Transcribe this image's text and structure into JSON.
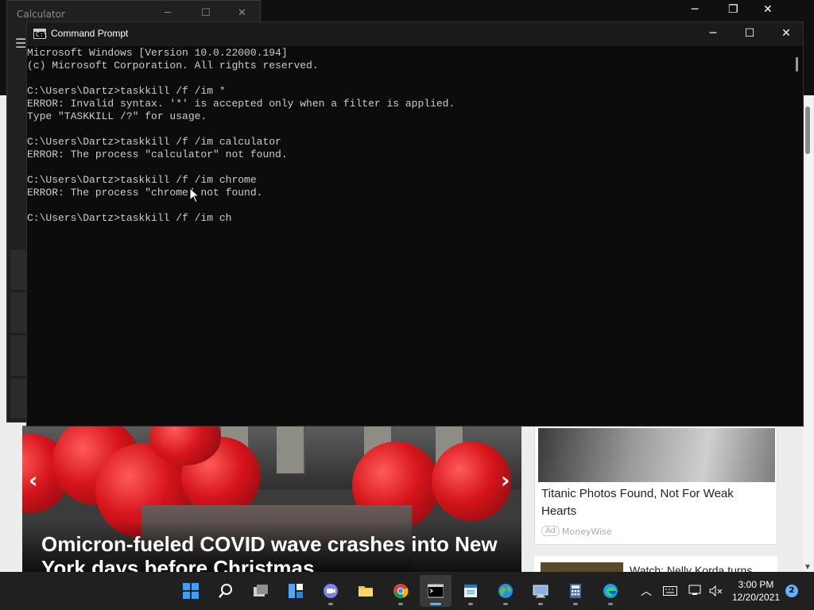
{
  "calculator": {
    "title": "Calculator",
    "minimize_icon": "minimize-icon",
    "maximize_icon": "maximize-icon",
    "close_icon": "close-icon",
    "menu_icon": "hamburger-icon"
  },
  "cmd": {
    "title": "Command Prompt",
    "app_icon": "cmd-icon",
    "lines": [
      "Microsoft Windows [Version 10.0.22000.194]",
      "(c) Microsoft Corporation. All rights reserved.",
      "",
      "C:\\Users\\Dartz>taskkill /f /im *",
      "ERROR: Invalid syntax. '*' is accepted only when a filter is applied.",
      "Type \"TASKKILL /?\" for usage.",
      "",
      "C:\\Users\\Dartz>taskkill /f /im calculator",
      "ERROR: The process \"calculator\" not found.",
      "",
      "C:\\Users\\Dartz>taskkill /f /im chrome",
      "ERROR: The process \"chrome\" not found.",
      "",
      "C:\\Users\\Dartz>taskkill /f /im ch"
    ]
  },
  "news": {
    "hero_headline": "Omicron-fueled COVID wave crashes into New York days before Christmas",
    "card1_title": "Titanic Photos Found, Not For Weak Hearts",
    "card1_ad": "Ad",
    "card1_source": "MoneyWise",
    "card2_title": "Watch: Nelly Korda turns"
  },
  "taskbar": {
    "time": "3:00 PM",
    "date": "12/20/2021",
    "notification_count": "2",
    "apps": [
      "start",
      "search",
      "task-view",
      "widgets",
      "teams-chat",
      "file-explorer",
      "chrome",
      "command-prompt",
      "notepad",
      "network-globe",
      "remote-desktop",
      "calculator",
      "edge"
    ]
  },
  "colors": {
    "console_bg": "#0c0c0c",
    "console_text": "#cccccc",
    "taskbar_bg": "#202020",
    "accent": "#5fb2ff"
  }
}
